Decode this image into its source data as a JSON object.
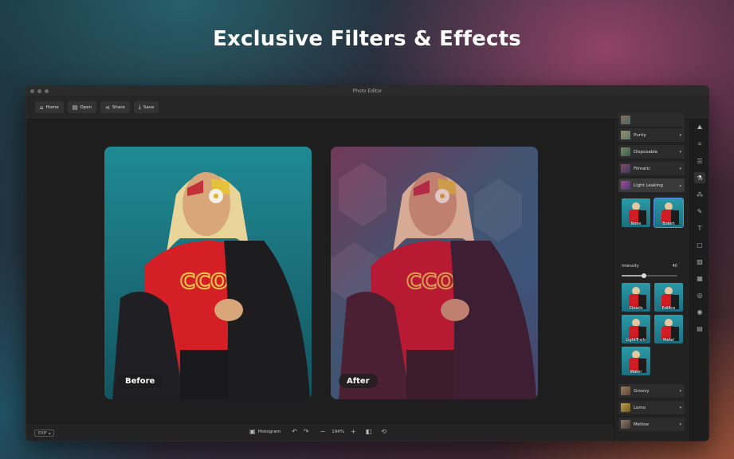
{
  "headline": "Exclusive Filters & Effects",
  "window": {
    "title": "Photo Editor"
  },
  "toolbar": {
    "home": "Home",
    "open": "Open",
    "share": "Share",
    "save": "Save"
  },
  "photos": {
    "before_label": "Before",
    "after_label": "After"
  },
  "bottombar": {
    "exif": "EXIF",
    "histogram": "Histogram",
    "zoom": "194%"
  },
  "filters": {
    "groups": [
      {
        "label": "Purity"
      },
      {
        "label": "Disposable"
      },
      {
        "label": "Filmatic"
      },
      {
        "label": "Light Leaking"
      },
      {
        "label": "Groovy"
      },
      {
        "label": "Lomo"
      },
      {
        "label": "Mellow"
      }
    ],
    "tiles": [
      {
        "label": "None"
      },
      {
        "label": "Bokeh"
      },
      {
        "label": "Clouds"
      },
      {
        "label": "Edifice"
      },
      {
        "label": "LightTrails"
      },
      {
        "label": "Metal"
      },
      {
        "label": "Water"
      }
    ],
    "intensity_label": "Intensity",
    "intensity_value": "40"
  },
  "colors": {
    "accent": "#5b8fe8",
    "window_bg": "#1b1b1b",
    "toolbar_bg": "#262626"
  }
}
